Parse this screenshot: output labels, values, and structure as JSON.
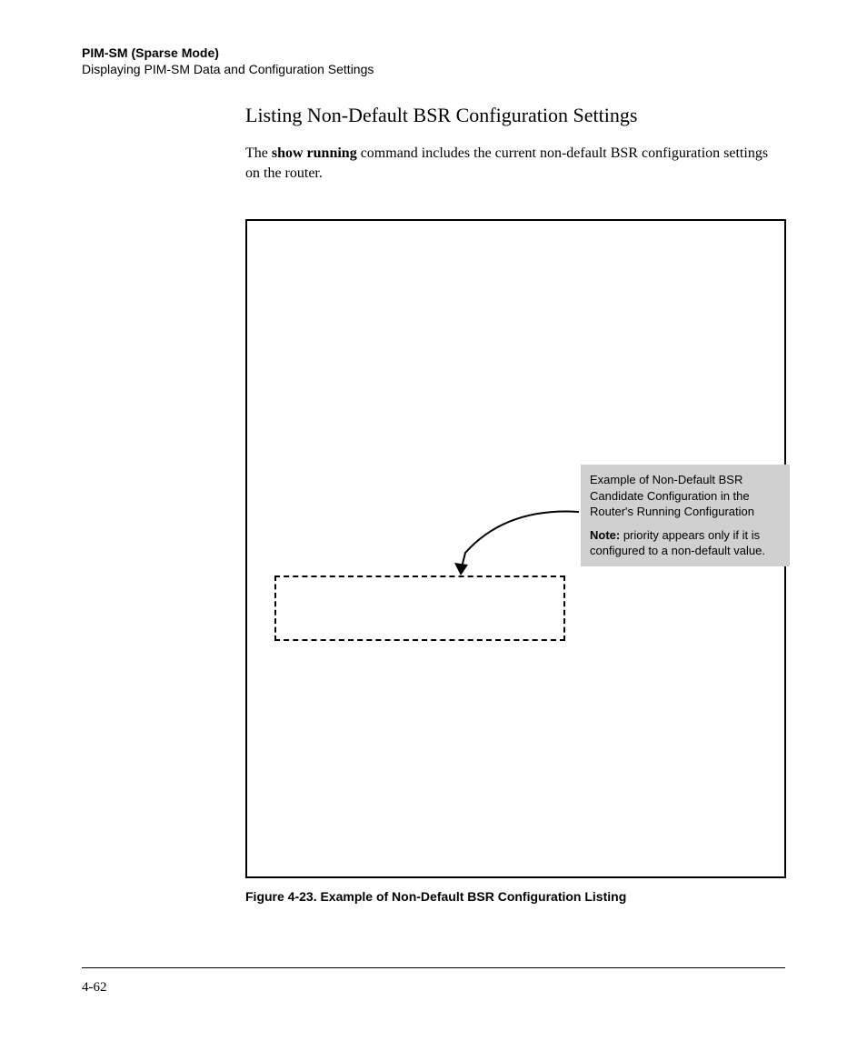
{
  "header": {
    "title": "PIM-SM (Sparse Mode)",
    "subtitle": "Displaying PIM-SM Data and Configuration Settings"
  },
  "section": {
    "heading": "Listing Non-Default BSR Configuration Settings",
    "body_prefix": "The ",
    "body_bold": "show running",
    "body_suffix": " command includes the current non-default BSR configuration settings on the router."
  },
  "callout": {
    "line1": "Example of Non-Default BSR Candidate Configuration in the Router's Running Configuration",
    "note_label": "Note:",
    "note_text": " priority appears only if it is configured to a non-default value."
  },
  "figure": {
    "caption": "Figure 4-23.  Example of Non-Default BSR Configuration Listing"
  },
  "page": {
    "number": "4-62"
  }
}
